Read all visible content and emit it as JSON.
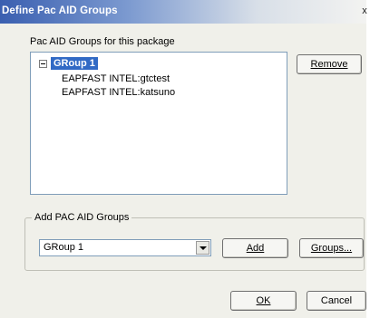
{
  "window": {
    "title": "Define Pac AID Groups",
    "close_glyph": "x"
  },
  "groups_panel": {
    "label": "Pac AID Groups for this package",
    "tree": {
      "group": "GRoup 1",
      "children": [
        "EAPFAST INTEL:gtctest",
        "EAPFAST INTEL:katsuno"
      ]
    },
    "remove_label": "Remove"
  },
  "add_panel": {
    "label": "Add PAC AID Groups",
    "selected_group": "GRoup 1",
    "add_label": "Add",
    "groups_label": "Groups..."
  },
  "footer": {
    "ok_label": "OK",
    "cancel_label": "Cancel"
  }
}
